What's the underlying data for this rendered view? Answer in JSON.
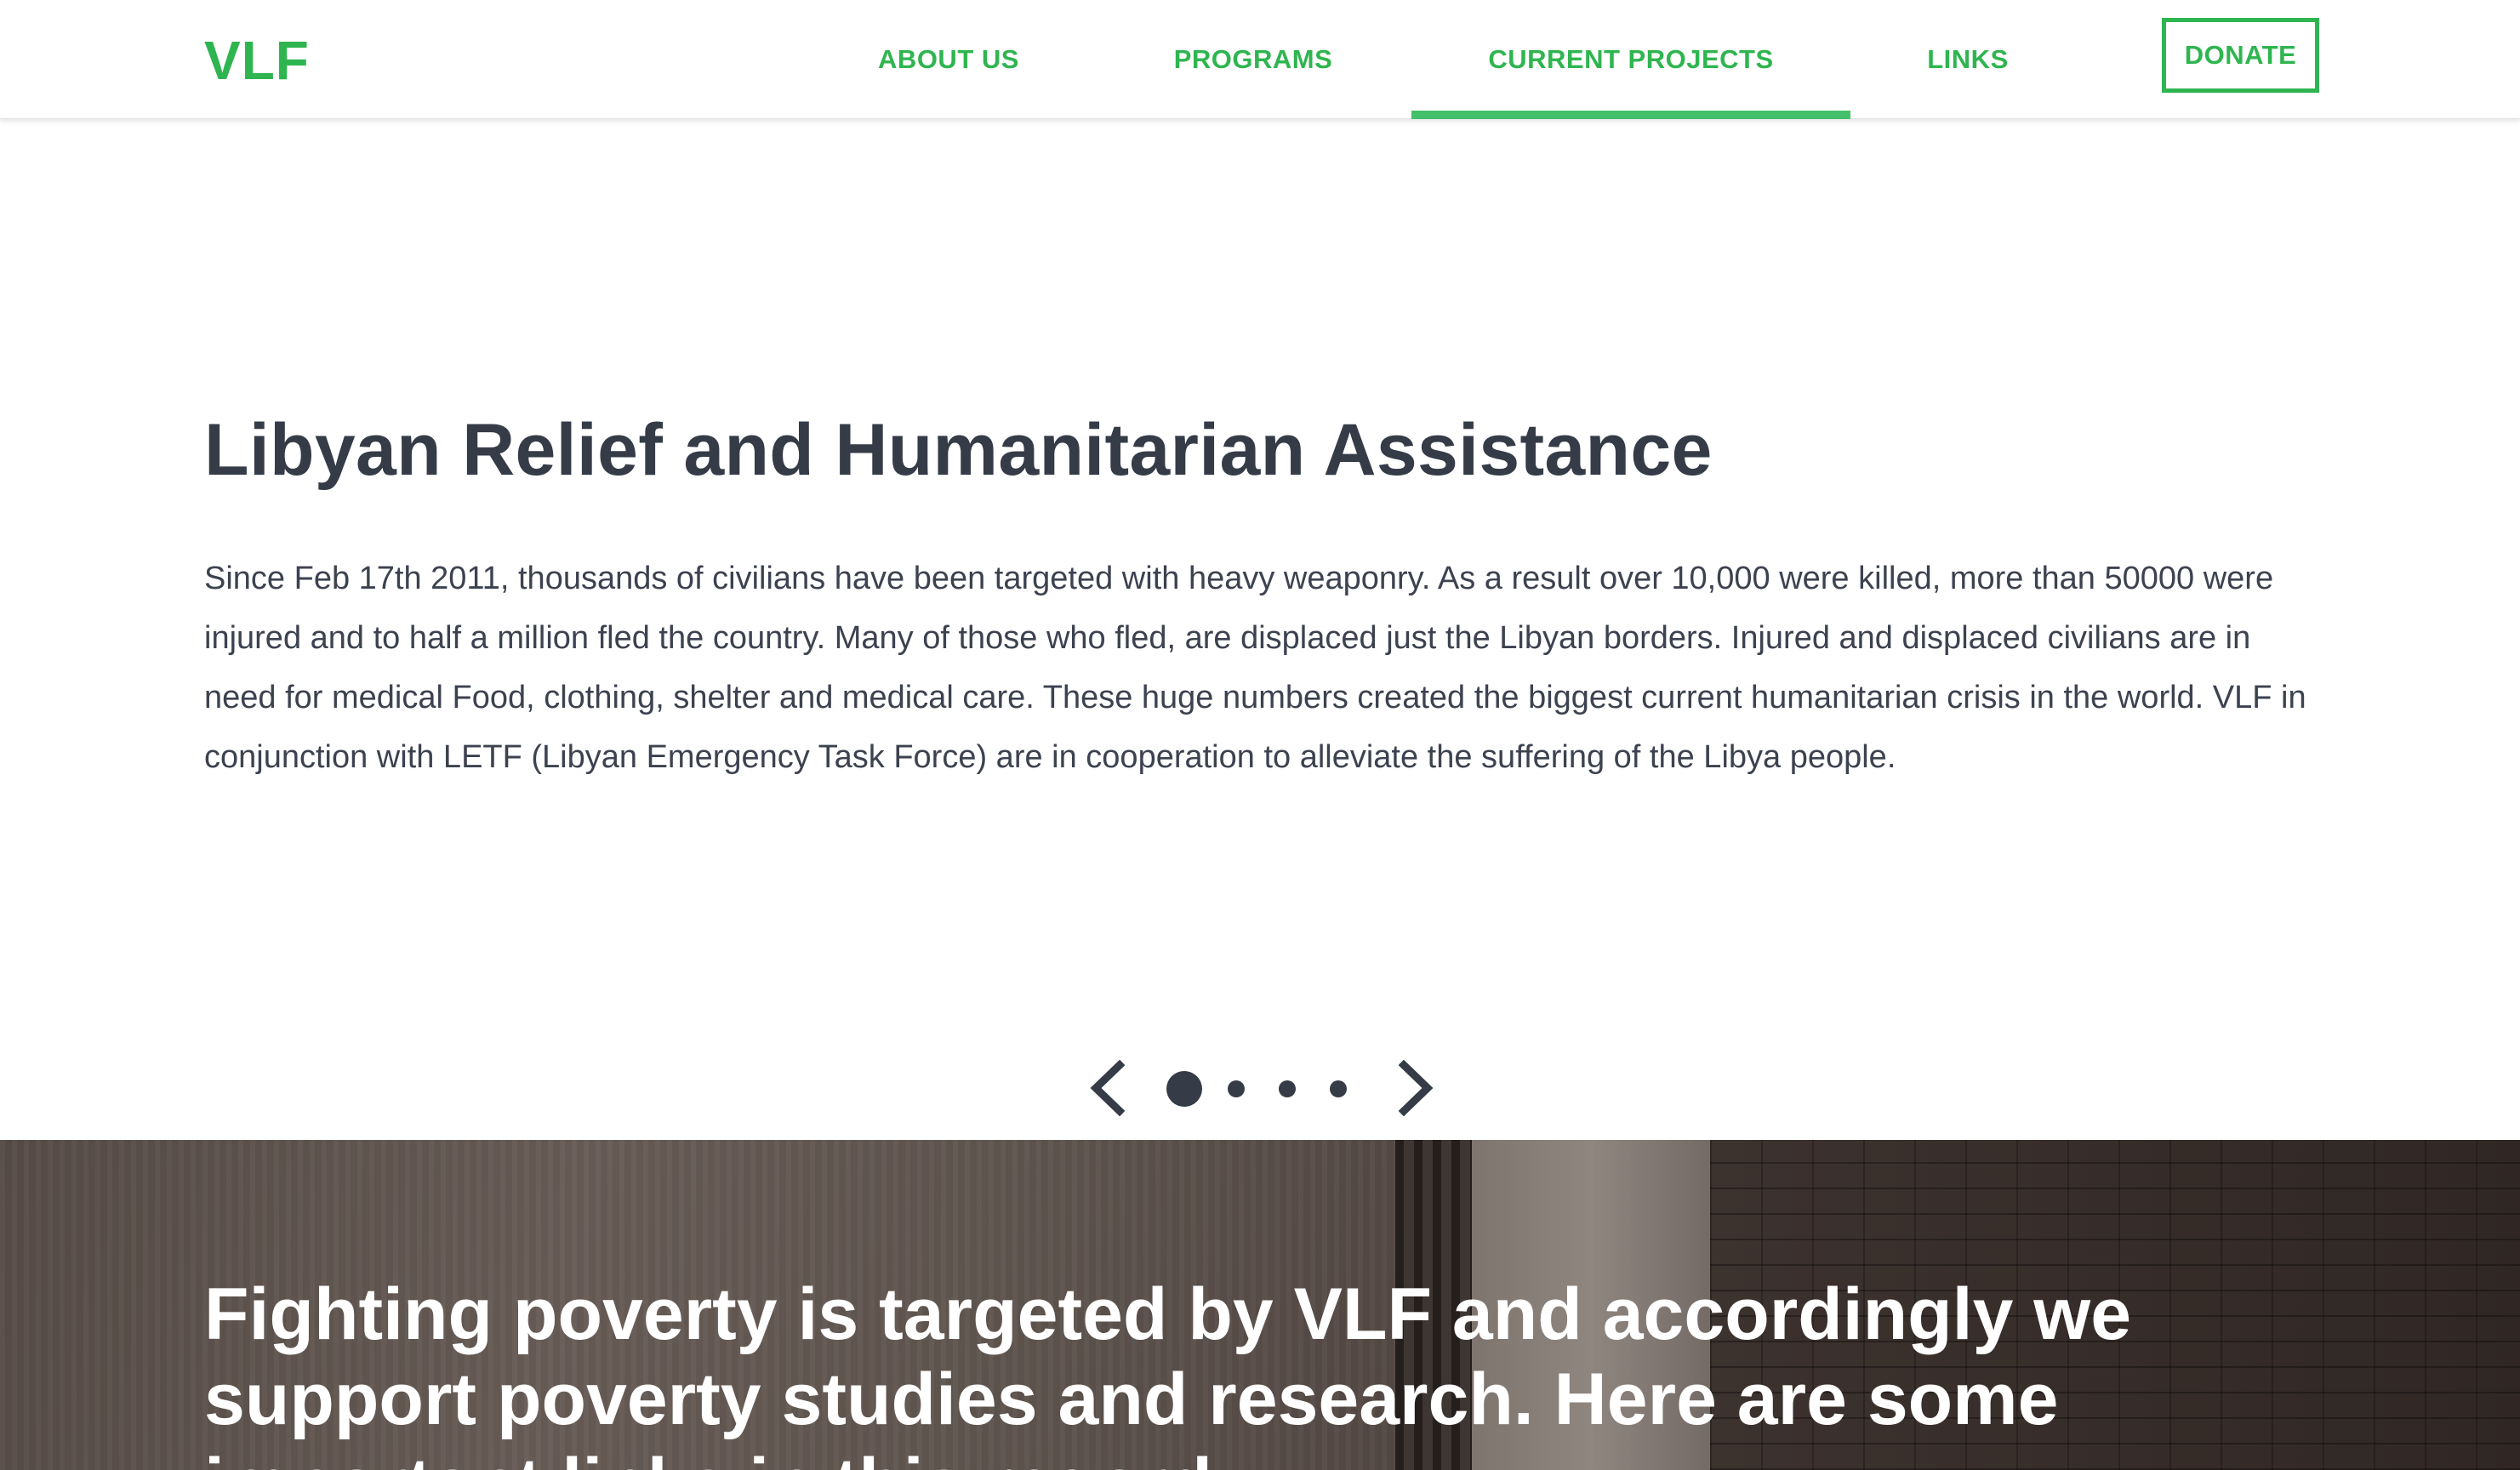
{
  "header": {
    "logo": "VLF",
    "nav": {
      "about": "ABOUT US",
      "programs": "PROGRAMS",
      "current_projects": "CURRENT PROJECTS",
      "links": "LINKS"
    },
    "donate_label": "DONATE",
    "active_item": "CURRENT PROJECTS"
  },
  "slide": {
    "title": "Libyan Relief and Humanitarian Assistance",
    "text": "Since Feb 17th 2011, thousands of civilians have been targeted with heavy weaponry. As a result over 10,000 were killed, more than 50000 were injured and to half a million fled the country. Many of those who fled, are displaced just the Libyan borders. Injured and displaced civilians are in need for medical Food, clothing, shelter and medical care. These huge numbers created the biggest current humanitarian crisis in the world. VLF in conjunction with LETF (Libyan Emergency Task Force) are in cooperation to alleviate the suffering of the Libya people."
  },
  "carousel": {
    "prev_icon": "chevron-left-icon",
    "next_icon": "chevron-right-icon",
    "slide_count": 4,
    "active_slide": 1
  },
  "hero": {
    "text": "Fighting poverty is targeted by VLF and accordingly we support poverty studies and research. Here are some important links in this regard:"
  },
  "colors": {
    "brand_green": "#2fb550",
    "active_underline": "#44c06a",
    "heading": "#353b47"
  }
}
